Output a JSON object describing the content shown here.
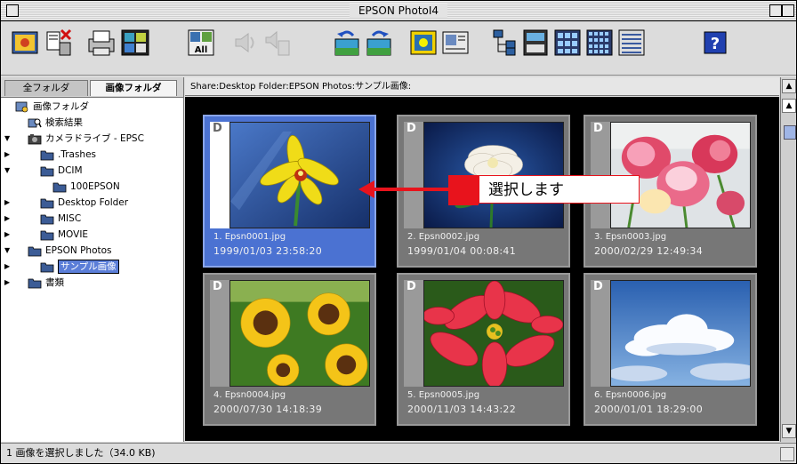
{
  "window": {
    "title": "EPSON PhotoI4"
  },
  "toolbar": {
    "tools": [
      {
        "name": "view-photo-icon"
      },
      {
        "name": "delete-icon"
      },
      {
        "name": "print-icon"
      },
      {
        "name": "slideshow-icon"
      },
      {
        "name": "all-icon"
      },
      {
        "name": "sound-icon"
      },
      {
        "name": "sound-delete-icon"
      },
      {
        "name": "rotate-left-icon"
      },
      {
        "name": "rotate-right-icon"
      },
      {
        "name": "image-edit-icon"
      },
      {
        "name": "image-info-icon"
      },
      {
        "name": "tree-icon"
      },
      {
        "name": "large-thumbs-icon"
      },
      {
        "name": "medium-thumbs-icon"
      },
      {
        "name": "small-thumbs-icon"
      },
      {
        "name": "list-view-icon"
      },
      {
        "name": "help-icon"
      }
    ],
    "help_label": "?",
    "all_label": "All"
  },
  "left_pane": {
    "tabs": [
      {
        "label": "全フォルダ",
        "active": false
      },
      {
        "label": "画像フォルダ",
        "active": true
      }
    ],
    "tree": [
      {
        "label": "画像フォルダ",
        "icon": "image-folder-icon",
        "level": 0,
        "expand": "",
        "selected": false
      },
      {
        "label": "検索結果",
        "icon": "search-result-icon",
        "level": 1,
        "expand": "",
        "selected": false
      },
      {
        "label": "カメラドライブ - EPSC",
        "icon": "camera-drive-icon",
        "level": 1,
        "expand": "open",
        "selected": false
      },
      {
        "label": ".Trashes",
        "icon": "folder-icon",
        "level": 2,
        "expand": "closed",
        "selected": false
      },
      {
        "label": "DCIM",
        "icon": "folder-icon",
        "level": 2,
        "expand": "open",
        "selected": false
      },
      {
        "label": "100EPSON",
        "icon": "folder-icon",
        "level": 3,
        "expand": "",
        "selected": false
      },
      {
        "label": "Desktop Folder",
        "icon": "folder-icon",
        "level": 2,
        "expand": "closed",
        "selected": false
      },
      {
        "label": "MISC",
        "icon": "folder-icon",
        "level": 2,
        "expand": "closed",
        "selected": false
      },
      {
        "label": "MOVIE",
        "icon": "folder-icon",
        "level": 2,
        "expand": "closed",
        "selected": false
      },
      {
        "label": "EPSON Photos",
        "icon": "folder-icon",
        "level": 1,
        "expand": "open",
        "selected": false
      },
      {
        "label": "サンプル画像",
        "icon": "folder-icon",
        "level": 2,
        "expand": "closed",
        "selected": true
      },
      {
        "label": "書類",
        "icon": "folder-icon",
        "level": 1,
        "expand": "closed",
        "selected": false
      }
    ]
  },
  "path": "Share:Desktop Folder:EPSON Photos:サンプル画像:",
  "thumbnails": [
    {
      "tag": "D",
      "caption": "1. Epsn0001.jpg",
      "date": "1999/01/03  23:58:20",
      "selected": true,
      "subject": "yellow-orchid"
    },
    {
      "tag": "D",
      "caption": "2. Epsn0002.jpg",
      "date": "1999/01/04  00:08:41",
      "selected": false,
      "subject": "white-flower"
    },
    {
      "tag": "D",
      "caption": "3. Epsn0003.jpg",
      "date": "2000/02/29  12:49:34",
      "selected": false,
      "subject": "tulips"
    },
    {
      "tag": "D",
      "caption": "4. Epsn0004.jpg",
      "date": "2000/07/30  14:18:39",
      "selected": false,
      "subject": "sunflowers"
    },
    {
      "tag": "D",
      "caption": "5. Epsn0005.jpg",
      "date": "2000/11/03  14:43:22",
      "selected": false,
      "subject": "poinsettia"
    },
    {
      "tag": "D",
      "caption": "6. Epsn0006.jpg",
      "date": "2000/01/01  18:29:00",
      "selected": false,
      "subject": "sky-clouds"
    }
  ],
  "callout": {
    "text": "選択します",
    "color": "#e8131c"
  },
  "status": {
    "text": "1 画像を選択しました（34.0 KB)"
  },
  "colors": {
    "selection": "#4b72d2",
    "grid_background": "#000000"
  }
}
